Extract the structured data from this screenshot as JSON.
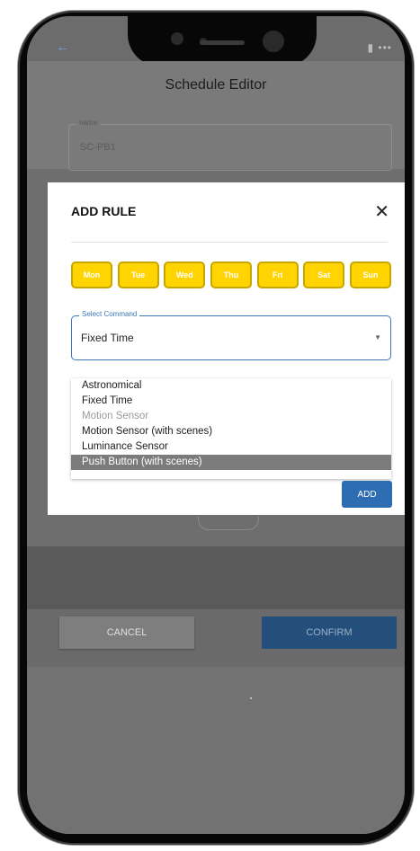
{
  "app": {
    "title": "Schedule Editor"
  },
  "status_bar": {
    "right_text": "▮ •••"
  },
  "name_field": {
    "label": "name",
    "value": "SC-PB1"
  },
  "modal": {
    "title": "ADD RULE",
    "close_glyph": "✕",
    "days": [
      "Mon",
      "Tue",
      "Wed",
      "Thu",
      "Fri",
      "Sat",
      "Sun"
    ],
    "select_label": "Select Command",
    "select_value": "Fixed Time",
    "options": [
      {
        "label": "Astronomical",
        "state": "normal"
      },
      {
        "label": "Fixed Time",
        "state": "normal"
      },
      {
        "label": "Motion Sensor",
        "state": "disabled"
      },
      {
        "label": "Motion Sensor (with scenes)",
        "state": "normal"
      },
      {
        "label": "Luminance Sensor",
        "state": "normal"
      },
      {
        "label": "Push Button (with scenes)",
        "state": "highlighted"
      }
    ],
    "add_label": "ADD"
  },
  "footer": {
    "cancel_label": "CANCEL",
    "confirm_label": "CONFIRM"
  },
  "colors": {
    "day_fill": "#ffd400",
    "primary": "#2f6db3",
    "select_border": "#3c78b8"
  }
}
